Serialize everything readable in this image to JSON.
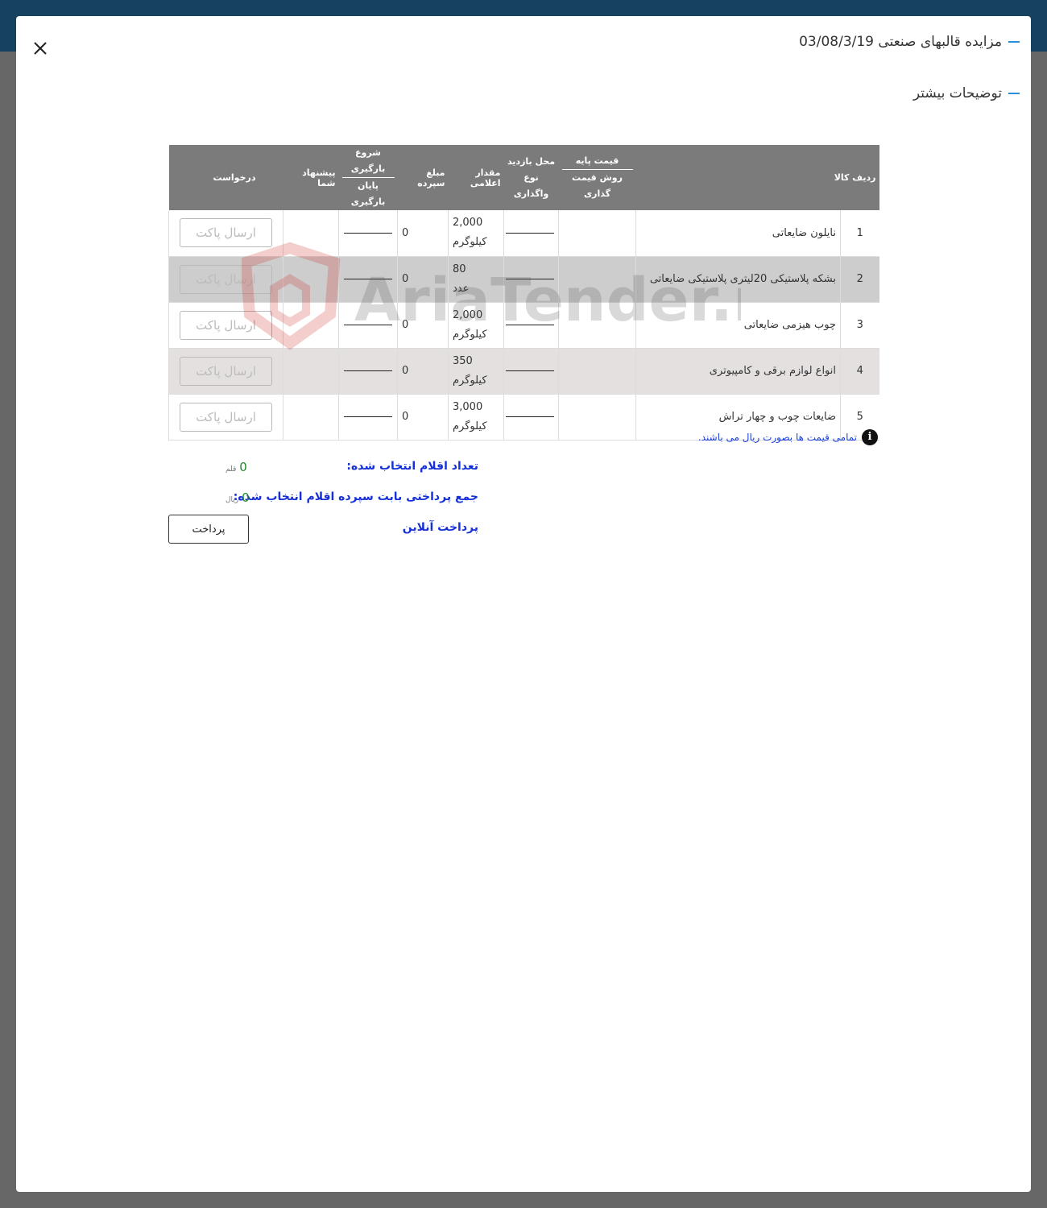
{
  "modal": {
    "title": "مزایده قالبهای صنعتی 03/08/3/19",
    "more_details": "توضیحات بیشتر"
  },
  "table": {
    "headers": {
      "row": "ردیف",
      "item": "کالا",
      "base_price": "قیمت پایه",
      "pricing_method": "روش قیمت گذاری",
      "visit_location": "محل بازدید",
      "assign_type": "نوع واگذاری",
      "announced_qty": "مقدار اعلامی",
      "deposit": "مبلغ سپرده",
      "load_start": "شروع بارگیری",
      "load_end": "پایان بارگیری",
      "your_offer": "پیشنهاد شما",
      "request": "درخواست"
    },
    "rows": [
      {
        "num": "1",
        "item": "نایلون ضایعاتی",
        "qty": "2,000",
        "unit": "کیلوگرم",
        "deposit": "0",
        "action": "ارسال پاکت"
      },
      {
        "num": "2",
        "item": "بشکه پلاستیکی 20لیتری پلاستیکی ضایعاتی",
        "qty": "80",
        "unit": "عدد",
        "deposit": "0",
        "action": "ارسال پاکت"
      },
      {
        "num": "3",
        "item": "چوب هیزمی ضایعاتی",
        "qty": "2,000",
        "unit": "کیلوگرم",
        "deposit": "0",
        "action": "ارسال پاکت"
      },
      {
        "num": "4",
        "item": "انواع لوازم برقی و کامپیوتری",
        "qty": "350",
        "unit": "کیلوگرم",
        "deposit": "0",
        "action": "ارسال پاکت"
      },
      {
        "num": "5",
        "item": "ضایعات چوب و چهار تراش",
        "qty": "3,000",
        "unit": "کیلوگرم",
        "deposit": "0",
        "action": "ارسال پاکت"
      }
    ]
  },
  "watermark_text": "AriaTender.neT",
  "note": "تمامی قیمت ها بصورت ریال می باشند.",
  "summary": {
    "selected_count_label": "تعداد اقلام انتخاب شده:",
    "selected_count_value": "0",
    "selected_count_unit": "قلم",
    "total_label": "جمع پرداختی بابت سپرده اقلام انتخاب شده:",
    "total_value": "0",
    "total_unit": "ریال",
    "online_pay_label": "پرداخت آنلاین",
    "pay_button": "پرداخت"
  },
  "colors": {
    "topbar": "#17425f",
    "header_bg": "#7b7b7b",
    "accent_dash": "#2c8ed6",
    "label_blue": "#1530d6",
    "value_green": "#1c8a2b"
  }
}
